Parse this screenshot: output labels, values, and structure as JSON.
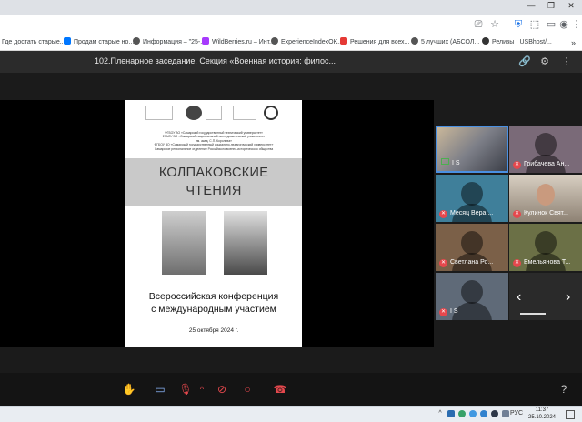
{
  "browser": {
    "toolbar_icons": [
      "cast-icon",
      "star-icon",
      "shield-icon",
      "extensions-icon",
      "sidepanel-icon",
      "profile-icon",
      "menu-icon"
    ],
    "bookmarks": [
      {
        "label": "Где достать старые...",
        "color": "#3b7ddd"
      },
      {
        "label": "Продам старые но...",
        "color": "#0077ff"
      },
      {
        "label": "Информация – \"25-...",
        "color": "#555555"
      },
      {
        "label": "WildBerries.ru – Инт...",
        "color": "#a73afd"
      },
      {
        "label": "ExperienceIndexOK...",
        "color": "#555555"
      },
      {
        "label": "Решения для всех...",
        "color": "#e53935"
      },
      {
        "label": "5 лучших (АБСОЛ...",
        "color": "#555555"
      },
      {
        "label": "Релизы · USBhost/...",
        "color": "#333333"
      }
    ]
  },
  "meeting": {
    "title": "102.Пленарное заседание. Секция «Военная история: филос..."
  },
  "slide": {
    "orgs": [
      "ФГБОУ ВО «Самарский государственный технический университет»",
      "ФГАОУ ВО «Самарский национальный исследовательский университет",
      "им. акад. С.П. Королёва»",
      "ФГБОУ ВО «Самарский государственный социально-педагогический университет»",
      "Самарское региональное отделение Российского военно-исторического общества"
    ],
    "title_line1": "КОЛПАКОВСКИЕ",
    "title_line2": "ЧТЕНИЯ",
    "conference_line1": "Всероссийская конференция",
    "conference_line2": "с международным участием",
    "date": "25 октября 2024 г."
  },
  "participants": [
    {
      "label": "I S",
      "muted": false,
      "bg": "#6f7c86"
    },
    {
      "label": "Грибачева Ан...",
      "muted": true,
      "bg": "#7a6a78"
    },
    {
      "label": "Месяц Вера ...",
      "muted": true,
      "bg": "#3f7f9a"
    },
    {
      "label": "Кулинок Свят...",
      "muted": true,
      "bg": "#b8a898"
    },
    {
      "label": "Светлана Ро...",
      "muted": true,
      "bg": "#7b6048"
    },
    {
      "label": "Емельянова Т...",
      "muted": true,
      "bg": "#6b7046"
    },
    {
      "label": "I S",
      "muted": true,
      "bg": "#5f6a78"
    }
  ],
  "taskbar": {
    "language": "РУС",
    "time": "11:37",
    "date": "25.10.2024"
  }
}
